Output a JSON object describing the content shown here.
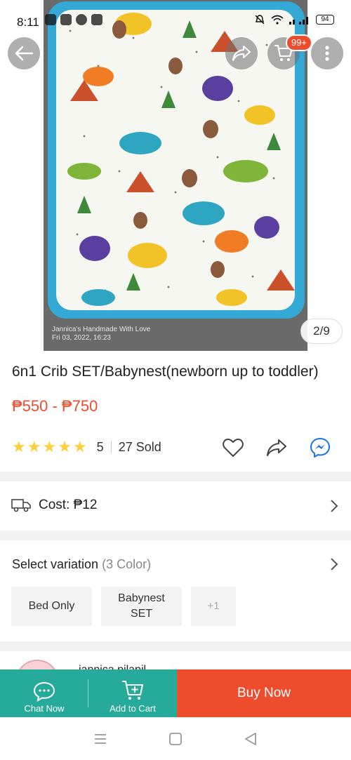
{
  "status_bar": {
    "time": "8:11",
    "battery": "94"
  },
  "top_overlay": {
    "back_icon": "arrow-left-icon",
    "share_icon": "share-arrow-icon",
    "cart_icon": "shopping-cart-icon",
    "cart_badge": "99+",
    "more_icon": "vertical-dots-icon"
  },
  "image": {
    "watermark_line1": "Jannica's Handmade With Love",
    "watermark_line2": "Fri 03, 2022, 16:23",
    "counter": "2/9"
  },
  "product": {
    "title": "6n1 Crib SET/Babynest(newborn up to toddler)",
    "price": "₱550 - ₱750",
    "rating": "5",
    "sold": "27 Sold",
    "stars": [
      "★",
      "★",
      "★",
      "★",
      "★"
    ]
  },
  "shipping": {
    "cost": "Cost: ₱12"
  },
  "variation": {
    "label": "Select variation",
    "count": "(3 Color)",
    "options": [
      {
        "label": "Bed Only"
      },
      {
        "label": "Babynest SET"
      },
      {
        "label": "+1"
      }
    ]
  },
  "seller": {
    "name": "jannica pilapil"
  },
  "bottom_bar": {
    "chat_label": "Chat Now",
    "cart_label": "Add to Cart",
    "buy_label": "Buy Now"
  },
  "colors": {
    "accent": "#ee4d2d",
    "green": "#26aa99",
    "star": "#ffce3d"
  }
}
